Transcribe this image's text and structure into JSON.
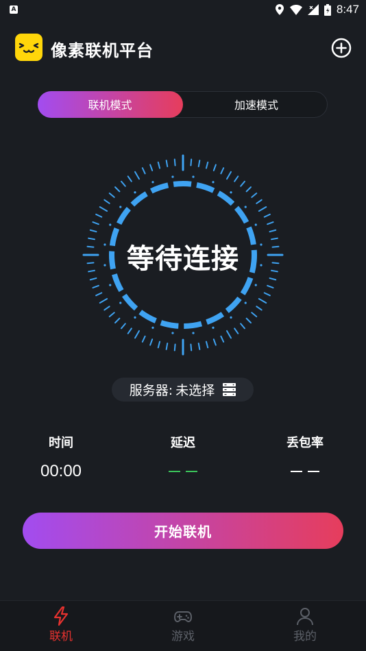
{
  "status_bar": {
    "time": "8:47",
    "notification_icon": "a-icon"
  },
  "header": {
    "title": "像素联机平台",
    "add_icon": "plus-circle-icon"
  },
  "mode_tabs": [
    {
      "label": "联机模式",
      "active": true
    },
    {
      "label": "加速模式",
      "active": false
    }
  ],
  "status": {
    "text": "等待连接"
  },
  "server": {
    "label": "服务器:",
    "value": "未选择",
    "icon": "server-icon"
  },
  "stats": [
    {
      "label": "时间",
      "value": "00:00"
    },
    {
      "label": "延迟",
      "value": "— —",
      "color": "#3bc45a"
    },
    {
      "label": "丢包率",
      "value": "— —",
      "color": "#ffffff"
    }
  ],
  "start_button": {
    "label": "开始联机"
  },
  "nav": [
    {
      "label": "联机",
      "icon": "lightning-icon",
      "active": true
    },
    {
      "label": "游戏",
      "icon": "gamepad-icon",
      "active": false
    },
    {
      "label": "我的",
      "icon": "user-icon",
      "active": false
    }
  ],
  "colors": {
    "background": "#1a1d22",
    "accent_gradient_start": "#a24cf0",
    "accent_gradient_end": "#e63d5c",
    "dial_blue": "#3fa3f2",
    "nav_active": "#e8322f",
    "nav_inactive": "#5c6068"
  }
}
